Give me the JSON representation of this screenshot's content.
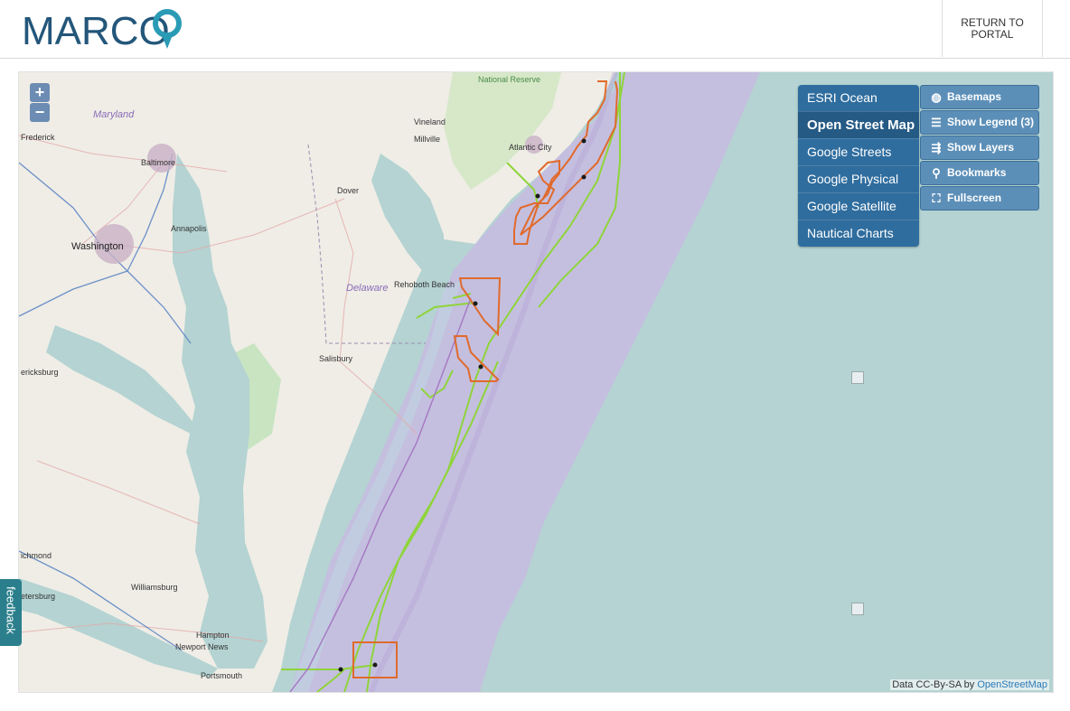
{
  "header": {
    "logo_text": "MARCO",
    "return_label_line1": "RETURN TO",
    "return_label_line2": "PORTAL"
  },
  "map": {
    "zoom_in": "+",
    "zoom_out": "−",
    "basemaps": [
      {
        "label": "ESRI Ocean",
        "active": false
      },
      {
        "label": "Open Street Map",
        "active": true
      },
      {
        "label": "Google Streets",
        "active": false
      },
      {
        "label": "Google Physical",
        "active": false
      },
      {
        "label": "Google Satellite",
        "active": false
      },
      {
        "label": "Nautical Charts",
        "active": false
      }
    ],
    "panel": {
      "basemaps": "Basemaps",
      "legend": "Show Legend (3)",
      "layers": "Show Layers",
      "bookmarks": "Bookmarks",
      "fullscreen": "Fullscreen"
    },
    "attribution_prefix": "Data CC-By-SA by",
    "attribution_link": "OpenStreetMap",
    "labels": {
      "maryland": "Maryland",
      "delaware": "Delaware",
      "frederick": "Frederick",
      "baltimore": "Baltimore",
      "washington": "Washington",
      "annapolis": "Annapolis",
      "dover": "Dover",
      "vineland": "Vineland",
      "millville": "Millville",
      "atlantic_city": "Atlantic City",
      "national_reserve": "National Reserve",
      "rehoboth": "Rehoboth Beach",
      "salisbury": "Salisbury",
      "fredericksburg": "ericksburg",
      "richmond": "ichmond",
      "petersburg": "etersburg",
      "williamsburg": "Williamsburg",
      "hampton": "Hampton",
      "newport_news": "Newport News",
      "portsmouth": "Portsmouth"
    }
  },
  "feedback_label": "feedback",
  "colors": {
    "brand": "#23567a",
    "pin": "#2a9bb5",
    "ocean": "#b4d3d2",
    "land": "#efede6",
    "shelf": "#c4bfdf",
    "lease_outline": "#e06a2c",
    "cable": "#8fd43a"
  }
}
